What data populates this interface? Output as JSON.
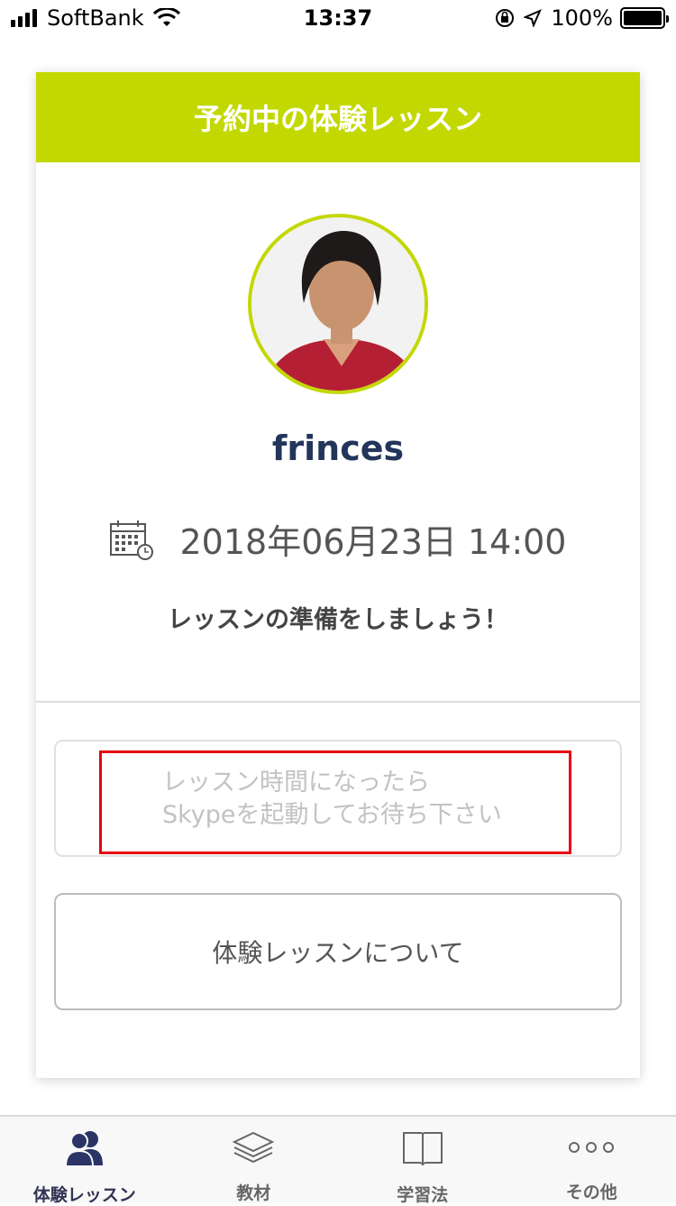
{
  "status_bar": {
    "carrier": "SoftBank",
    "time": "13:37",
    "battery_percent": "100%"
  },
  "card": {
    "header_title": "予約中の体験レッスン",
    "teacher_name": "frinces",
    "date_time": "2018年06月23日 14:00",
    "prepare_message": "レッスンの準備をしましょう！",
    "notice_line1": "レッスン時間になったら",
    "notice_line2": "Skypeを起動してお待ち下さい",
    "about_button_label": "体験レッスンについて"
  },
  "tab_bar": {
    "tabs": [
      {
        "label": "体験レッスン",
        "icon": "users-icon",
        "active": true
      },
      {
        "label": "教材",
        "icon": "layers-icon",
        "active": false
      },
      {
        "label": "学習法",
        "icon": "book-icon",
        "active": false
      },
      {
        "label": "その他",
        "icon": "more-dots-icon",
        "active": false
      }
    ]
  },
  "colors": {
    "accent": "#c3d800",
    "name_text": "#23355a",
    "highlight_border": "#e60012"
  }
}
